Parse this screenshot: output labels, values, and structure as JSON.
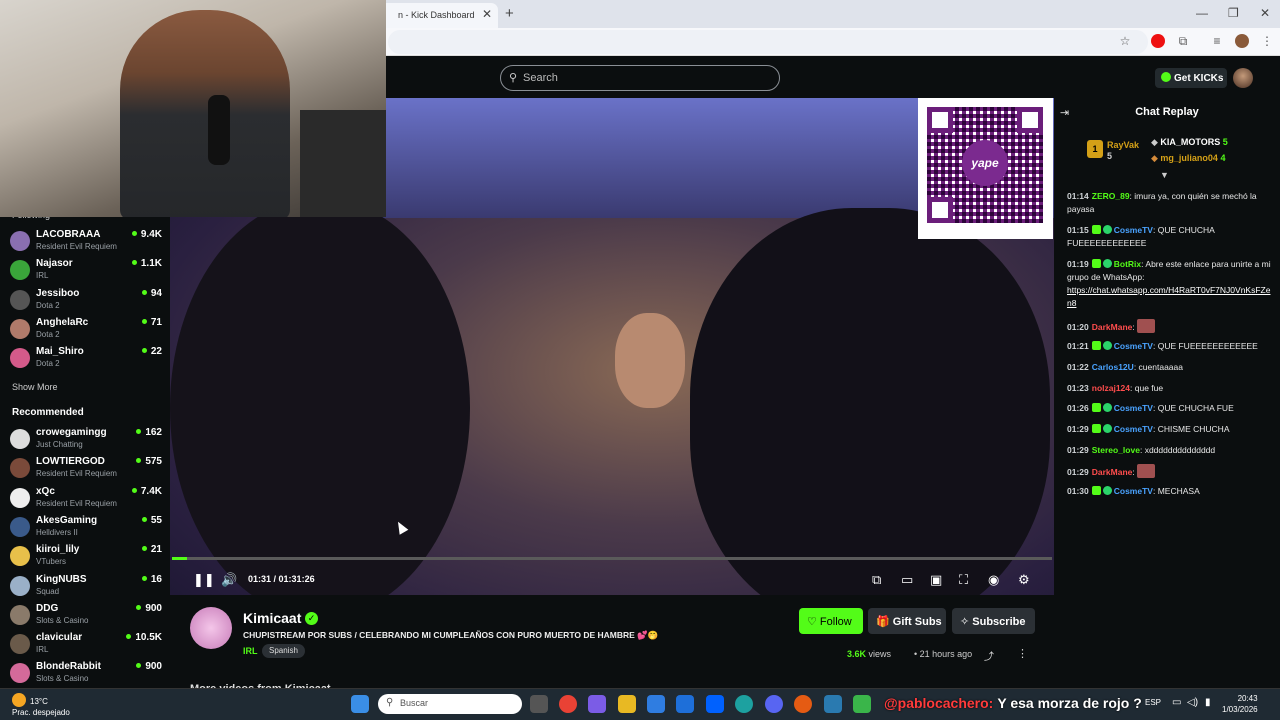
{
  "browser": {
    "tab_title": "n - Kick Dashboard",
    "tab_close": "✕",
    "new_tab": "+",
    "win_min": "—",
    "win_max": "❐",
    "win_close": "✕"
  },
  "header": {
    "search_placeholder": "Search",
    "get_kicks_label": "Get KICKs"
  },
  "sidebar": {
    "following_label": "Following",
    "following": [
      {
        "name": "LACOBRAAA",
        "category": "Resident Evil Requiem",
        "viewers": "9.4K",
        "color": "#8a6fb0"
      },
      {
        "name": "Najasor",
        "category": "IRL",
        "viewers": "1.1K",
        "color": "#3aa53a"
      },
      {
        "name": "Jessiboo",
        "category": "Dota 2",
        "viewers": "94",
        "color": "#555"
      },
      {
        "name": "AnghelaRc",
        "category": "Dota 2",
        "viewers": "71",
        "color": "#b07a6a"
      },
      {
        "name": "Mai_Shiro",
        "category": "Dota 2",
        "viewers": "22",
        "color": "#d45a8a"
      }
    ],
    "show_more": "Show More",
    "recommended_label": "Recommended",
    "recommended": [
      {
        "name": "crowegamingg",
        "category": "Just Chatting",
        "viewers": "162",
        "color": "#ddd"
      },
      {
        "name": "LOWTIERGOD",
        "category": "Resident Evil Requiem",
        "viewers": "575",
        "color": "#7a4a3a"
      },
      {
        "name": "xQc",
        "category": "Resident Evil Requiem",
        "viewers": "7.4K",
        "color": "#eee"
      },
      {
        "name": "AkesGaming",
        "category": "Helldivers II",
        "viewers": "55",
        "color": "#3a5a8a"
      },
      {
        "name": "kiiroi_lily",
        "category": "VTubers",
        "viewers": "21",
        "color": "#e8c04a"
      },
      {
        "name": "KingNUBS",
        "category": "Squad",
        "viewers": "16",
        "color": "#9ab0c8"
      },
      {
        "name": "DDG",
        "category": "Slots & Casino",
        "viewers": "900",
        "color": "#8a7a6a"
      },
      {
        "name": "clavicular",
        "category": "IRL",
        "viewers": "10.5K",
        "color": "#6a5a4a"
      },
      {
        "name": "BlondeRabbit",
        "category": "Slots & Casino",
        "viewers": "900",
        "color": "#d46a9a"
      }
    ]
  },
  "player": {
    "time_current": "01:31",
    "time_total": "01:31:26",
    "time_separator": " / ",
    "progress_fraction": 0.017,
    "qr_label": "yape",
    "icons": {
      "pause": "❚❚",
      "volume": "🔊",
      "pip": "⧉",
      "theater": "▭",
      "clip": "▣",
      "fullscreen": "⛶",
      "speed": "◉",
      "settings": "⚙"
    }
  },
  "chat": {
    "title": "Chat Replay",
    "top_gifters": [
      {
        "rank": "1",
        "name": "RayVak",
        "count": "5"
      },
      {
        "name": "KIA_MOTORS",
        "count": "5"
      },
      {
        "name": "mg_juliano04",
        "count": "4"
      }
    ],
    "messages": [
      {
        "time": "01:14",
        "user": "ZERO_89",
        "color": "#53fc18",
        "text": "imura ya, con quién se mechó la payasa"
      },
      {
        "time": "01:15",
        "user": "CosmeTV",
        "color": "#4aa3ff",
        "text": "QUE CHUCHA FUEEEEEEEEEEEE"
      },
      {
        "time": "01:19",
        "user": "BotRix",
        "color": "#53fc18",
        "text": "Abre este enlace para unirte a mi grupo de WhatsApp:",
        "link": "https://chat.whatsapp.com/H4RaRT0vF7NJ0VnKsFZen8"
      },
      {
        "time": "01:20",
        "user": "DarkMane",
        "color": "#ff4d4d",
        "text": ""
      },
      {
        "time": "01:21",
        "user": "CosmeTV",
        "color": "#4aa3ff",
        "text": "QUE FUEEEEEEEEEEEE"
      },
      {
        "time": "01:22",
        "user": "Carlos12U",
        "color": "#4aa3ff",
        "text": "cuentaaaaa"
      },
      {
        "time": "01:23",
        "user": "nolzaj124",
        "color": "#ff4d4d",
        "text": "que fue"
      },
      {
        "time": "01:26",
        "user": "CosmeTV",
        "color": "#4aa3ff",
        "text": "QUE CHUCHA FUE"
      },
      {
        "time": "01:29",
        "user": "CosmeTV",
        "color": "#4aa3ff",
        "text": "CHISME CHUCHA"
      },
      {
        "time": "01:29",
        "user": "Stereo_love",
        "color": "#53fc18",
        "text": "xdddddddddddddd"
      },
      {
        "time": "01:29",
        "user": "DarkMane",
        "color": "#ff4d4d",
        "text": ""
      },
      {
        "time": "01:30",
        "user": "CosmeTV",
        "color": "#4aa3ff",
        "text": "MECHASA"
      }
    ]
  },
  "channel": {
    "name": "Kimicaat",
    "title": "CHUPISTREAM POR SUBS / CELEBRANDO MI CUMPLEAÑOS CON PURO MUERTO DE HAMBRE 💕🤭",
    "category": "IRL",
    "language": "Spanish",
    "follow_label": "Follow",
    "gift_label": "Gift Subs",
    "subscribe_label": "Subscribe",
    "views_count": "3.6K",
    "views_label": " views",
    "ago": "• 21 hours ago",
    "more_videos": "More videos from Kimicaat"
  },
  "taskbar": {
    "temp": "13°C",
    "weather": "Prac. despejado",
    "search_placeholder": "Buscar",
    "overlay_user": "@pablocachero:",
    "overlay_text": "Y esa morza de rojo ?",
    "lang": "ESP",
    "time": "20:43",
    "date": "1/03/2026"
  }
}
